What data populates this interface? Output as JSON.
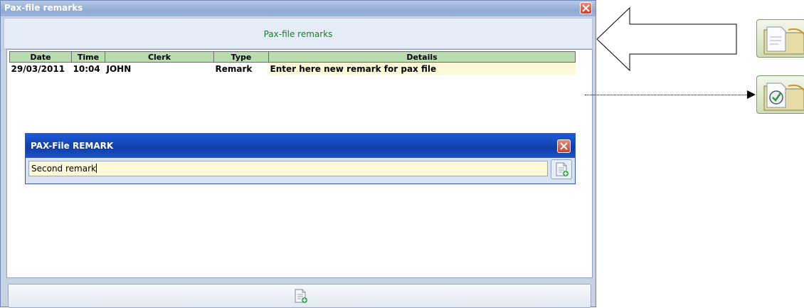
{
  "window": {
    "title": "Pax-file remarks",
    "header": "Pax-file remarks"
  },
  "grid": {
    "columns": [
      "Date",
      "Time",
      "Clerk",
      "Type",
      "Details"
    ],
    "rows": [
      {
        "date": "29/03/2011",
        "time": "10:04",
        "clerk": "JOHN",
        "type": "Remark",
        "details": "Enter here new remark for pax file"
      }
    ]
  },
  "dialog": {
    "title": "PAX-File REMARK",
    "input_value": "Second remark"
  },
  "icons": {
    "close": "close-icon",
    "save_document": "document-add-icon",
    "folder_document": "folder-document-icon",
    "folder_check": "folder-check-icon"
  },
  "colors": {
    "header_text": "#1a7d2a",
    "grid_header": "#b9ddb0",
    "dialog_titlebar": "#1e5bd6",
    "close_button": "#c9412e"
  }
}
